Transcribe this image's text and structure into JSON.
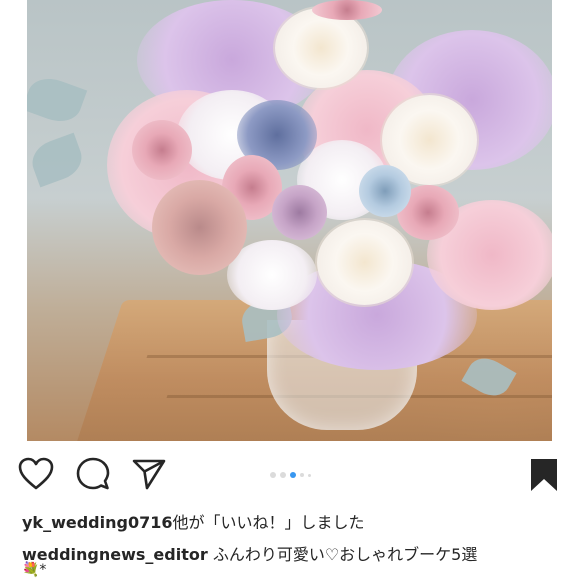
{
  "post": {
    "photo_alt": "",
    "carousel": {
      "count": 5,
      "active_index": 2
    },
    "likes_user": "yk_wedding0716",
    "likes_suffix": "他が「いいね！」しました",
    "caption_user": "weddingnews_editor",
    "caption_text": "ふんわり可愛い♡おしゃれブーケ5選",
    "caption_overflow": "💐*"
  },
  "icons": {
    "like": "heart-icon",
    "comment": "comment-icon",
    "share": "send-icon",
    "save": "bookmark-icon"
  },
  "colors": {
    "text": "#262626",
    "dot_active": "#3897f0",
    "dot_inactive": "#dbdbdb"
  }
}
